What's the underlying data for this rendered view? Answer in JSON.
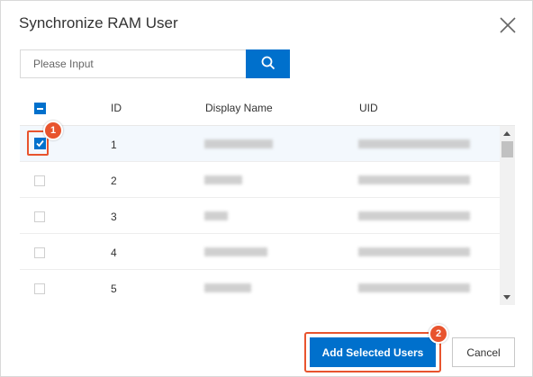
{
  "dialog": {
    "title": "Synchronize RAM User",
    "close_icon": "close-icon"
  },
  "search": {
    "placeholder": "Please Input",
    "value": "",
    "button_icon": "search-icon"
  },
  "table": {
    "columns": [
      "ID",
      "Display Name",
      "UID"
    ],
    "header_checkbox_state": "indeterminate",
    "rows": [
      {
        "id": "1",
        "checked": true
      },
      {
        "id": "2",
        "checked": false
      },
      {
        "id": "3",
        "checked": false
      },
      {
        "id": "4",
        "checked": false
      },
      {
        "id": "5",
        "checked": false
      }
    ]
  },
  "annotations": {
    "step1": "1",
    "step2": "2",
    "color": "#e8542e"
  },
  "footer": {
    "primary_label": "Add Selected Users",
    "cancel_label": "Cancel"
  },
  "colors": {
    "primary": "#0070cc",
    "highlight": "#e8542e"
  }
}
